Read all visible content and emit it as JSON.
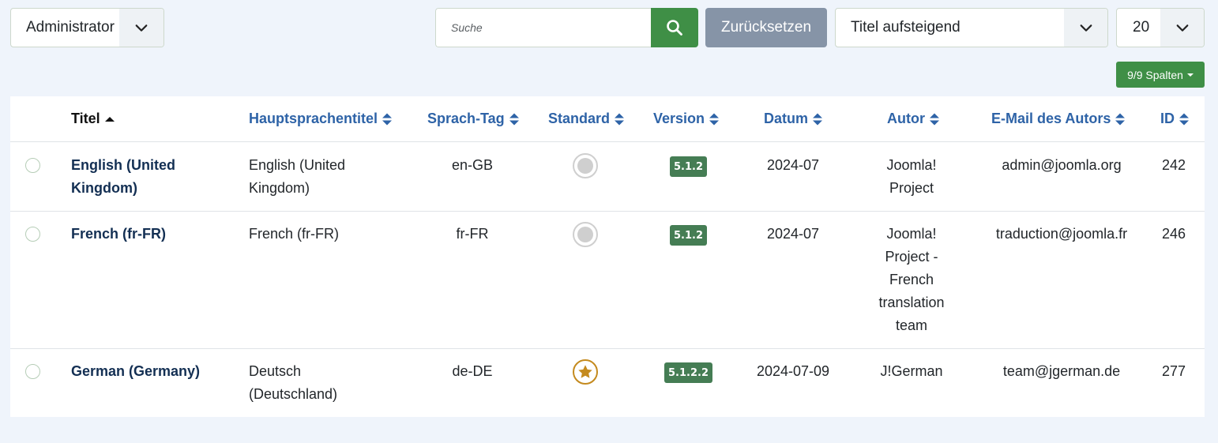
{
  "toolbar": {
    "client_filter": {
      "value": "Administrator",
      "icon": "chevron-down-icon"
    },
    "search": {
      "placeholder": "Suche",
      "value": "",
      "icon": "search-icon"
    },
    "reset_label": "Zurücksetzen",
    "sort": {
      "value": "Titel aufsteigend",
      "icon": "chevron-down-icon"
    },
    "limit": {
      "value": "20",
      "icon": "chevron-down-icon"
    },
    "columns_label": "9/9 Spalten"
  },
  "colors": {
    "accent_green": "#3f8f46",
    "reset_gray": "#8694a7",
    "header_link": "#2e63a7",
    "badge_green": "#457d54",
    "star_gold": "#c48a1e",
    "background": "#eff4fb"
  },
  "table": {
    "columns": [
      {
        "key": "title",
        "label": "Titel",
        "sort": "asc"
      },
      {
        "key": "native_title",
        "label": "Hauptsprachentitel",
        "sort": "both"
      },
      {
        "key": "lang_tag",
        "label": "Sprach-Tag",
        "sort": "both"
      },
      {
        "key": "default",
        "label": "Standard",
        "sort": "both"
      },
      {
        "key": "version",
        "label": "Version",
        "sort": "both"
      },
      {
        "key": "date",
        "label": "Datum",
        "sort": "both"
      },
      {
        "key": "author",
        "label": "Autor",
        "sort": "both"
      },
      {
        "key": "author_email",
        "label": "E-Mail des Autors",
        "sort": "both"
      },
      {
        "key": "id",
        "label": "ID",
        "sort": "both"
      }
    ],
    "rows": [
      {
        "title": "English (United Kingdom)",
        "native_title": "English (United Kingdom)",
        "lang_tag": "en-GB",
        "default": false,
        "version": "5.1.2",
        "date": "2024-07",
        "author": "Joomla! Project",
        "author_email": "admin@joomla.org",
        "id": "242"
      },
      {
        "title": "French (fr-FR)",
        "native_title": "French (fr-FR)",
        "lang_tag": "fr-FR",
        "default": false,
        "version": "5.1.2",
        "date": "2024-07",
        "author": "Joomla! Project - French translation team",
        "author_email": "traduction@joomla.fr",
        "id": "246"
      },
      {
        "title": "German (Germany)",
        "native_title": "Deutsch (Deutschland)",
        "lang_tag": "de-DE",
        "default": true,
        "version": "5.1.2.2",
        "date": "2024-07-09",
        "author": "J!German",
        "author_email": "team@jgerman.de",
        "id": "277"
      }
    ]
  }
}
